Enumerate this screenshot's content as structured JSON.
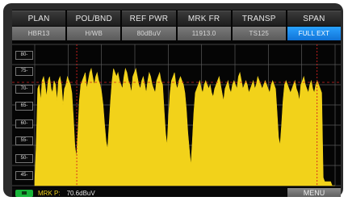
{
  "menu": {
    "labels": [
      "PLAN",
      "POL/BND",
      "REF PWR",
      "MRK FR",
      "TRANSP",
      "SPAN"
    ],
    "values": [
      "HBR13",
      "H/WB",
      "80dBuV",
      "11913.0",
      "TS125",
      "FULL EXT"
    ],
    "active_index": 5
  },
  "scale": [
    "80-",
    "75-",
    "70-",
    "65-",
    "60-",
    "55-",
    "50-",
    "45-"
  ],
  "status": {
    "marker_label": "MRK P:",
    "marker_value": "70.6dBuV",
    "menu_button": "MENU"
  },
  "colors": {
    "trace": "#f2d21a",
    "grid": "#5a5a5a",
    "marker": "#d42020",
    "active": "#1e8cf0"
  },
  "chart_data": {
    "type": "area",
    "title": "",
    "xlabel": "",
    "ylabel": "dBuV",
    "ylim": [
      45,
      80
    ],
    "grid": true,
    "marker_value": 70.6,
    "values": [
      46,
      55,
      69,
      70,
      66,
      71,
      72,
      70,
      67,
      71,
      72,
      69,
      68,
      71,
      70,
      66,
      71,
      72,
      70,
      65,
      69,
      70,
      72,
      71,
      70,
      68,
      62,
      55,
      52,
      58,
      66,
      70,
      71,
      72,
      73,
      69,
      71,
      73,
      74,
      72,
      70,
      72,
      73,
      71,
      70,
      68,
      65,
      60,
      56,
      54,
      60,
      66,
      71,
      74,
      73,
      72,
      73,
      71,
      70,
      69,
      72,
      74,
      73,
      71,
      70,
      68,
      72,
      73,
      74,
      72,
      70,
      69,
      71,
      72,
      70,
      68,
      71,
      73,
      72,
      70,
      69,
      68,
      71,
      72,
      73,
      71,
      70,
      64,
      58,
      55,
      62,
      68,
      71,
      72,
      73,
      70,
      69,
      71,
      72,
      71,
      70,
      68,
      64,
      58,
      54,
      50,
      56,
      63,
      68,
      69,
      70,
      71,
      69,
      68,
      70,
      71,
      70,
      69,
      70,
      68,
      67,
      69,
      70,
      71,
      72,
      70,
      68,
      66,
      69,
      70,
      71,
      69,
      68,
      70,
      71,
      70,
      69,
      72,
      73,
      71,
      69,
      70,
      71,
      70,
      68,
      69,
      70,
      71,
      69,
      70,
      72,
      71,
      70,
      69,
      70,
      71,
      70,
      69,
      68,
      70,
      71,
      70,
      69,
      63,
      57,
      55,
      60,
      66,
      70,
      71,
      70,
      69,
      68,
      69,
      70,
      71,
      69,
      68,
      66,
      70,
      71,
      72,
      70,
      69,
      68,
      70,
      71,
      69,
      68,
      70,
      71,
      70,
      69,
      68,
      47,
      46,
      46,
      46,
      46,
      46,
      45,
      45,
      45
    ]
  }
}
